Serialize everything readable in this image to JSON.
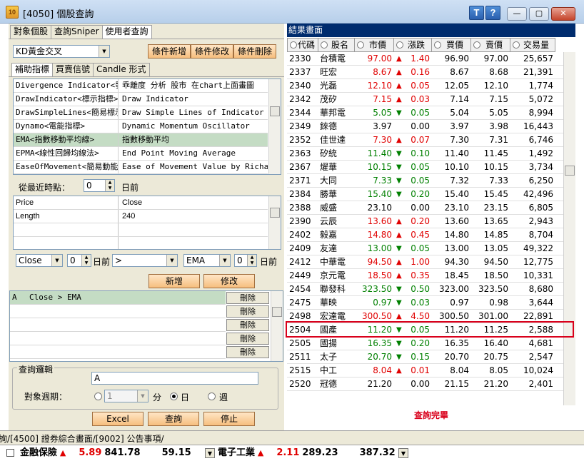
{
  "window": {
    "title": "[4050] 個股查詢",
    "help_t": "T",
    "help_q": "?",
    "min": "—",
    "max": "▢",
    "close": "✕"
  },
  "left": {
    "tabs": [
      "對象個股",
      "查詢Sniper",
      "使用者查詢"
    ],
    "strategy": "KD黃金交叉",
    "buttons": {
      "add": "條件新增",
      "modify": "條件修改",
      "delete": "條件刪除"
    },
    "subtabs": [
      "補助指標",
      "買賣信號",
      "Candle 形式"
    ],
    "indicators": [
      {
        "name": "Divergence Indicator<發散",
        "desc": "乖離度 分析 股市 在chart上面畫圖"
      },
      {
        "name": "DrawIndicator<標示指標>",
        "desc": "Draw Indicator"
      },
      {
        "name": "DrawSimpleLines<簡易標示",
        "desc": "Draw Simple Lines of Indicator"
      },
      {
        "name": "Dynamo<電能指標>",
        "desc": "Dynamic Momentum Oscillator"
      },
      {
        "name": "EMA<指數移動平均線>",
        "desc": "指數移動平均"
      },
      {
        "name": "EPMA<線性回歸均線法>",
        "desc": "End Point Moving Average"
      },
      {
        "name": "EaseOfMovement<簡易動能",
        "desc": "Ease of Movement Value by Richard W"
      }
    ],
    "recent_label": "從最近時點：",
    "recent_value": "0",
    "days_before": "日前",
    "params": [
      {
        "k": "Price",
        "v": "Close"
      },
      {
        "k": "Length",
        "v": "240"
      },
      {
        "k": "",
        "v": ""
      },
      {
        "k": "",
        "v": ""
      }
    ],
    "cond": {
      "field1": "Close",
      "n1": "0",
      "days1": "日前",
      "op": ">",
      "field2": "EMA",
      "n2": "0",
      "days2": "日前"
    },
    "btn_add": "新增",
    "btn_modify": "修改",
    "conditions": [
      {
        "id": "A",
        "expr": "Close > EMA"
      }
    ],
    "del_label": "刪除",
    "logic_title": "查詢邏輯",
    "logic_value": "A",
    "period_label": "對象週期：",
    "period_value": "1",
    "period_min": "分",
    "period_day": "日",
    "period_week": "週",
    "btn_excel": "Excel",
    "btn_query": "查詢",
    "btn_stop": "停止"
  },
  "right": {
    "title": "結果畫面",
    "columns": [
      "代碼",
      "股名",
      "市價",
      "漲跌",
      "買價",
      "賣價",
      "交易量"
    ],
    "rows": [
      [
        "2330",
        "台積電",
        "97.00",
        "up",
        "1.40",
        "96.90",
        "97.00",
        "25,657"
      ],
      [
        "2337",
        "旺宏",
        "8.67",
        "up",
        "0.16",
        "8.67",
        "8.68",
        "21,391"
      ],
      [
        "2340",
        "光磊",
        "12.10",
        "up",
        "0.05",
        "12.05",
        "12.10",
        "1,774"
      ],
      [
        "2342",
        "茂矽",
        "7.15",
        "up",
        "0.03",
        "7.14",
        "7.15",
        "5,072"
      ],
      [
        "2344",
        "華邦電",
        "5.05",
        "dn",
        "0.05",
        "5.04",
        "5.05",
        "8,994"
      ],
      [
        "2349",
        "錸德",
        "3.97",
        "fl",
        "0.00",
        "3.97",
        "3.98",
        "16,443"
      ],
      [
        "2352",
        "佳世達",
        "7.30",
        "up",
        "0.07",
        "7.30",
        "7.31",
        "6,746"
      ],
      [
        "2363",
        "矽統",
        "11.40",
        "dn",
        "0.10",
        "11.40",
        "11.45",
        "1,492"
      ],
      [
        "2367",
        "燿華",
        "10.15",
        "dn",
        "0.05",
        "10.10",
        "10.15",
        "3,734"
      ],
      [
        "2371",
        "大同",
        "7.33",
        "dn",
        "0.05",
        "7.32",
        "7.33",
        "6,250"
      ],
      [
        "2384",
        "勝華",
        "15.40",
        "dn",
        "0.20",
        "15.40",
        "15.45",
        "42,496"
      ],
      [
        "2388",
        "威盛",
        "23.10",
        "fl",
        "0.00",
        "23.10",
        "23.15",
        "6,805"
      ],
      [
        "2390",
        "云辰",
        "13.60",
        "up",
        "0.20",
        "13.60",
        "13.65",
        "2,943"
      ],
      [
        "2402",
        "毅嘉",
        "14.80",
        "up",
        "0.45",
        "14.80",
        "14.85",
        "8,704"
      ],
      [
        "2409",
        "友達",
        "13.00",
        "dn",
        "0.05",
        "13.00",
        "13.05",
        "49,322"
      ],
      [
        "2412",
        "中華電",
        "94.50",
        "up",
        "1.00",
        "94.30",
        "94.50",
        "12,775"
      ],
      [
        "2449",
        "京元電",
        "18.50",
        "up",
        "0.35",
        "18.45",
        "18.50",
        "10,331"
      ],
      [
        "2454",
        "聯發科",
        "323.50",
        "dn",
        "0.50",
        "323.00",
        "323.50",
        "8,680"
      ],
      [
        "2475",
        "華映",
        "0.97",
        "dn",
        "0.03",
        "0.97",
        "0.98",
        "3,644"
      ],
      [
        "2498",
        "宏達電",
        "300.50",
        "up",
        "4.50",
        "300.50",
        "301.00",
        "22,891"
      ],
      [
        "2504",
        "國產",
        "11.20",
        "dn",
        "0.05",
        "11.20",
        "11.25",
        "2,588"
      ],
      [
        "2505",
        "國揚",
        "16.35",
        "dn",
        "0.20",
        "16.35",
        "16.40",
        "4,681"
      ],
      [
        "2511",
        "太子",
        "20.70",
        "dn",
        "0.15",
        "20.70",
        "20.75",
        "2,547"
      ],
      [
        "2515",
        "中工",
        "8.04",
        "up",
        "0.01",
        "8.04",
        "8.05",
        "10,024"
      ],
      [
        "2520",
        "冠德",
        "21.20",
        "fl",
        "0.00",
        "21.15",
        "21.20",
        "2,401"
      ]
    ],
    "done": "查詢完畢"
  },
  "status_tabs": "詢/[4500] 證券綜合畫面/[9002] 公告事項/",
  "ticker": [
    {
      "name": "金融保險",
      "change": "5.89",
      "index": "841.78",
      "vol": "59.15"
    },
    {
      "name": "電子工業",
      "change": "2.11",
      "index": "289.23",
      "vol": "387.32"
    }
  ],
  "colors": {
    "up": "#e00000",
    "down": "#008000",
    "header": "#002c6e",
    "highlight": "#d9001b"
  }
}
